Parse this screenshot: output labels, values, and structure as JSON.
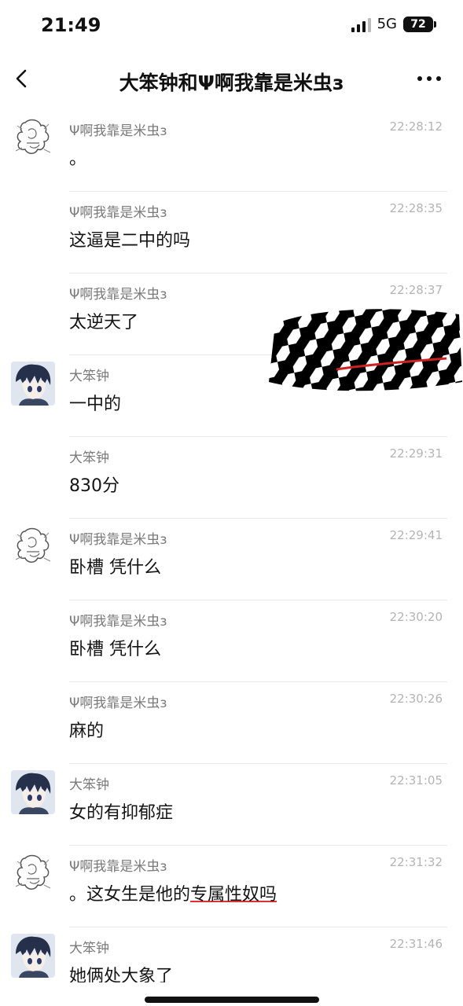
{
  "status_bar": {
    "time": "21:49",
    "network": "5G",
    "battery": "72"
  },
  "nav": {
    "title": "大笨钟和Ψ啊我靠是米虫з"
  },
  "messages": [
    {
      "sender": "Ψ啊我靠是米虫з",
      "time": "22:28:12",
      "text": "。",
      "avatar": "sketch-avatar"
    },
    {
      "sender": "Ψ啊我靠是米虫з",
      "time": "22:28:35",
      "text": "这逼是二中的吗",
      "avatar": ""
    },
    {
      "sender": "Ψ啊我靠是米虫з",
      "time": "22:28:37",
      "text": "太逆天了",
      "avatar": ""
    },
    {
      "sender": "大笨钟",
      "time": "",
      "text": "一中的",
      "avatar": "anime-avatar"
    },
    {
      "sender": "大笨钟",
      "time": "22:29:31",
      "text": "830分",
      "avatar": ""
    },
    {
      "sender": "Ψ啊我靠是米虫з",
      "time": "22:29:41",
      "text": "卧槽 凭什么",
      "avatar": "sketch-avatar"
    },
    {
      "sender": "Ψ啊我靠是米虫з",
      "time": "22:30:20",
      "text": "卧槽 凭什么",
      "avatar": ""
    },
    {
      "sender": "Ψ啊我靠是米虫з",
      "time": "22:30:26",
      "text": "麻的",
      "avatar": ""
    },
    {
      "sender": "大笨钟",
      "time": "22:31:05",
      "text": "女的有抑郁症",
      "avatar": "anime-avatar"
    },
    {
      "sender": "Ψ啊我靠是米虫з",
      "time": "22:31:32",
      "text_a": "。这女生是他的",
      "text_b": "专属性奴吗",
      "avatar": "sketch-avatar"
    },
    {
      "sender": "大笨钟",
      "time": "22:31:46",
      "text": "她俩处大象了",
      "avatar": "anime-avatar"
    }
  ],
  "icons": {
    "back": "chevron-left-icon",
    "more": "more-horizontal-icon"
  },
  "colors": {
    "background": "#ffffff",
    "sender": "#7a7a7a",
    "time": "#b4b4b4",
    "text": "#141414",
    "underline": "#d33333"
  }
}
